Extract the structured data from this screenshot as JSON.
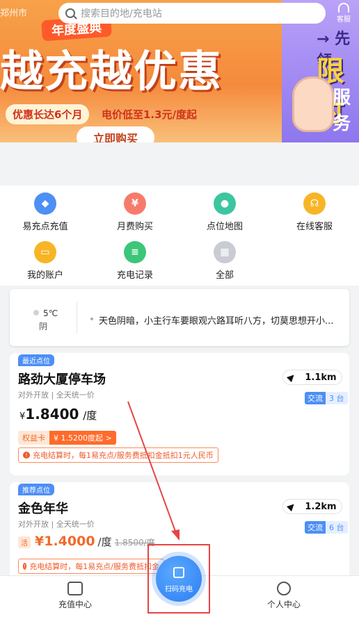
{
  "header": {
    "city": "郑州市",
    "search_placeholder": "搜索目的地/充电站",
    "service_label": "客服"
  },
  "banner": {
    "tag": "年度盛典",
    "main": "越充越优惠",
    "sub1": "优惠长达6个月",
    "sub2": "电价低至1.3元/度起",
    "buy": "立即购买",
    "right1": "→ 先领",
    "right2": "限时",
    "right3": "服务"
  },
  "grid": [
    {
      "label": "易充点充值",
      "color": "#4d8ff5",
      "icon": "tag-icon"
    },
    {
      "label": "月费购买",
      "color": "#f77b6b",
      "icon": "money-bag-icon"
    },
    {
      "label": "点位地图",
      "color": "#3cc6a0",
      "icon": "map-pin-icon"
    },
    {
      "label": "在线客服",
      "color": "#f7b526",
      "icon": "headset-icon"
    },
    {
      "label": "我的账户",
      "color": "#f7b526",
      "icon": "wallet-icon"
    },
    {
      "label": "充电记录",
      "color": "#3cc67a",
      "icon": "record-icon"
    },
    {
      "label": "全部",
      "color": "#c9ccd2",
      "icon": "grid-icon"
    }
  ],
  "weather": {
    "temp": "5℃",
    "desc": "阴",
    "tip": "天色阴暗，小主行车要眼观六路耳听八方，切莫思想开小..."
  },
  "station1": {
    "tag": "最近点位",
    "name": "路劲大厦停车场",
    "sub": "对外开放 | 全天统一价",
    "distance": "1.1km",
    "ac": "交流",
    "count": "3 台",
    "currency": "¥",
    "price": "1.8400",
    "unit": "/度",
    "rights_a": "权益卡",
    "rights_b": "¥ 1.5200度起 >",
    "notice": "充电结算时，每1易充点/服务费抵扣金抵扣1元人民币"
  },
  "station2": {
    "tag": "推荐点位",
    "name": "金色年华",
    "sub": "对外开放 | 全天统一价",
    "distance": "1.2km",
    "ac": "交流",
    "count": "6 台",
    "huo": "活",
    "price": "¥1.4000",
    "unit": "/度",
    "old": "1.8500/度",
    "notice": "充电结算时，每1易充点/服务费抵扣金"
  },
  "tabbar": {
    "recharge": "充值中心",
    "scan": "扫码充电",
    "me": "个人中心"
  }
}
